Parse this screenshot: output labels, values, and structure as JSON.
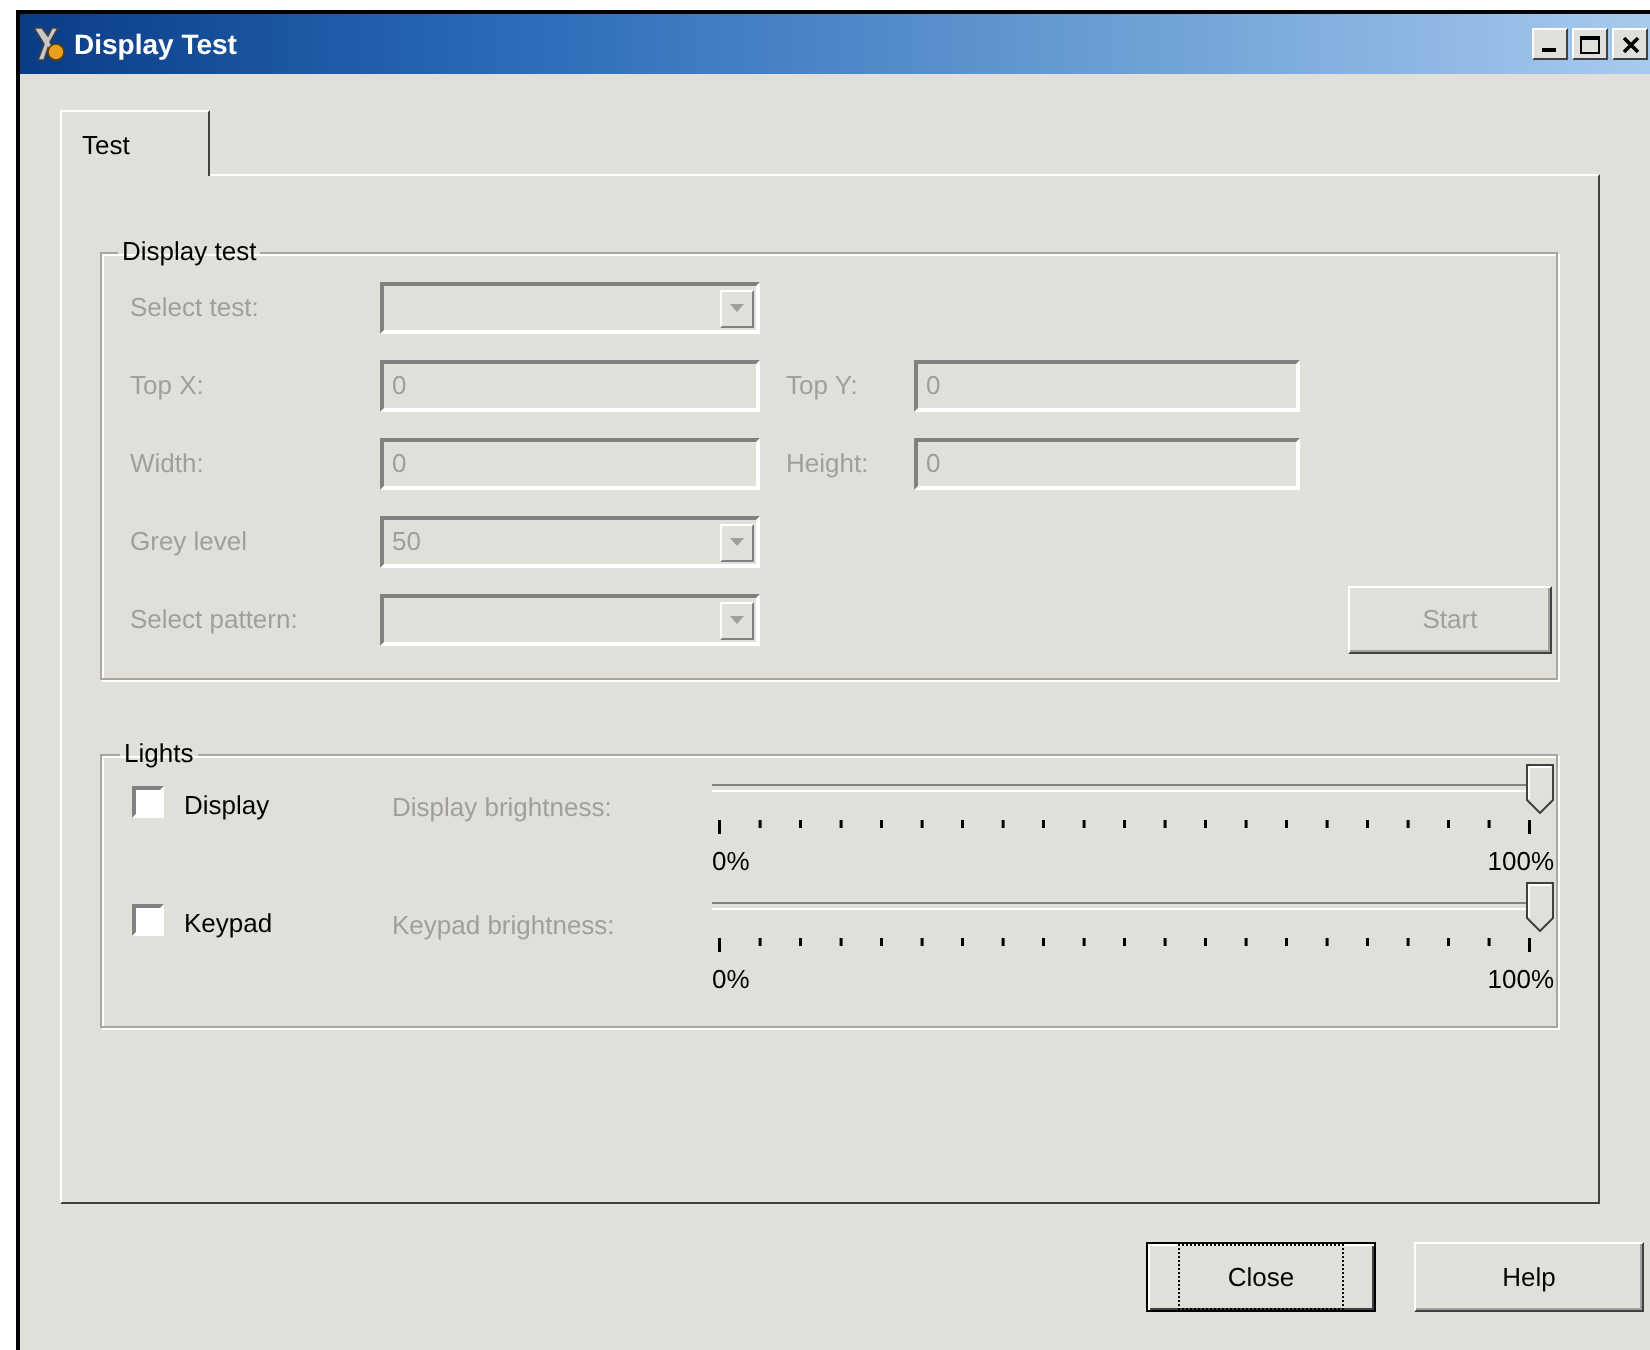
{
  "window": {
    "title": "Display Test"
  },
  "tabs": [
    {
      "label": "Test",
      "selected": true
    }
  ],
  "display_test": {
    "title": "Display test",
    "rows": [
      [
        {
          "kind": "combo",
          "label": "Select test:",
          "disabled": true
        }
      ],
      [
        {
          "kind": "text",
          "label": "Top X:",
          "value": "0",
          "disabled": true
        },
        {
          "kind": "text",
          "label": "Top Y:",
          "value": "0",
          "disabled": true
        }
      ],
      [
        {
          "kind": "text",
          "label": "Width:",
          "value": "0",
          "disabled": true
        },
        {
          "kind": "text",
          "label": "Height:",
          "value": "0",
          "disabled": true
        }
      ],
      [
        {
          "kind": "combo",
          "label": "Grey level",
          "value": "50",
          "disabled": true
        }
      ],
      [
        {
          "kind": "combo",
          "label": "Select pattern:",
          "disabled": true
        },
        {
          "kind": "button",
          "label": "Start",
          "disabled": true
        }
      ]
    ]
  },
  "lights": {
    "title": "Lights",
    "items": [
      {
        "label": "Display",
        "checked": false,
        "slider_label": "Display brightness:",
        "slider_disabled": true,
        "min_label": "0%",
        "max_label": "100%"
      },
      {
        "label": "Keypad",
        "checked": false,
        "slider_label": "Keypad brightness:",
        "slider_disabled": true,
        "min_label": "0%",
        "max_label": "100%"
      }
    ]
  },
  "buttons": [
    {
      "label": "Close",
      "default": true
    },
    {
      "label": "Help",
      "default": false
    }
  ]
}
